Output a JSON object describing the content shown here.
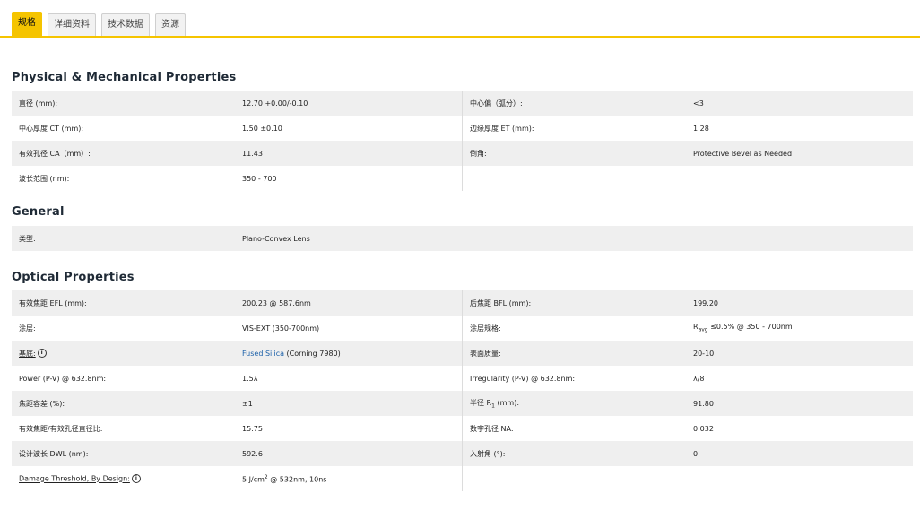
{
  "tabs": [
    "规格",
    "详细资料",
    "技术数据",
    "资源"
  ],
  "sections": {
    "physical": {
      "title": "Physical & Mechanical Properties",
      "rows": [
        [
          "直径 (mm):",
          "12.70 +0.00/-0.10",
          "中心偏（弧分）:",
          "<3"
        ],
        [
          "中心厚度 CT (mm):",
          "1.50 ±0.10",
          "边缘厚度 ET (mm):",
          "1.28"
        ],
        [
          "有效孔径 CA（mm）:",
          "11.43",
          "倒角:",
          "Protective Bevel as Needed"
        ],
        [
          "波长范围 (nm):",
          "350 - 700",
          "",
          ""
        ]
      ]
    },
    "general": {
      "title": "General",
      "rows": [
        [
          "类型:",
          "Plano-Convex Lens"
        ]
      ]
    },
    "optical": {
      "title": "Optical Properties",
      "rows": [
        [
          "有效焦距 EFL (mm):",
          "200.23 @ 587.6nm",
          "后焦距 BFL (mm):",
          "199.20"
        ],
        [
          "涂层:",
          "VIS-EXT (350-700nm)",
          "涂层规格:",
          "≤0.5% @ 350 - 700nm"
        ],
        [
          "基底:",
          "Fused Silica",
          "表面质量:",
          "20-10"
        ],
        [
          "Power (P-V) @ 632.8nm:",
          "1.5λ",
          "Irregularity (P-V) @ 632.8nm:",
          "λ/8"
        ],
        [
          "焦距容差 (%):",
          "±1",
          "半径 R",
          "91.80"
        ],
        [
          "有效焦距/有效孔径直径比:",
          "15.75",
          "数字孔径 NA:",
          "0.032"
        ],
        [
          "设计波长 DWL (nm):",
          "592.6",
          "入射角 (°):",
          "0"
        ],
        [
          "Damage Threshold, By Design:",
          "5 J/cm",
          "",
          ""
        ]
      ],
      "extras": {
        "coating_spec_prefix": "R",
        "coating_spec_sub": "avg",
        "substrate_note": "(Corning 7980)",
        "radius_sub": "1",
        "radius_suffix": "(mm):",
        "damage_sup": "2",
        "damage_suffix": "@ 532nm, 10ns",
        "info_glyph": "i"
      }
    }
  }
}
